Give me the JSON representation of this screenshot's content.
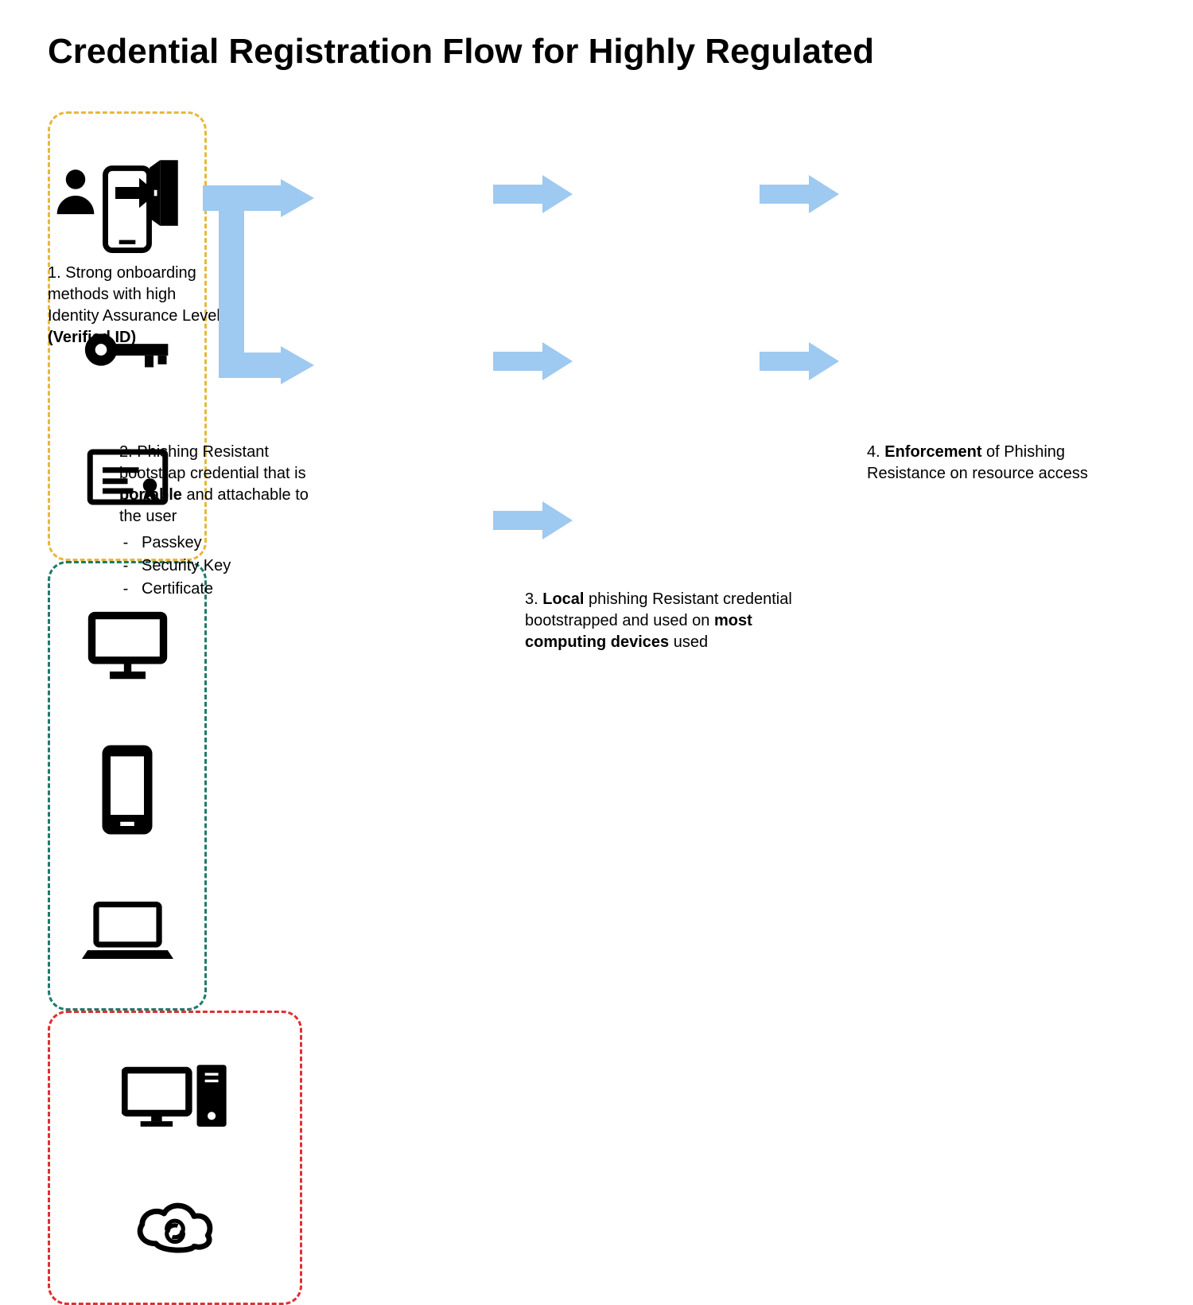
{
  "title": "Credential Registration Flow for Highly Regulated",
  "step1": {
    "prefix": "1. Strong onboarding methods with high Identity Assurance Level ",
    "bold": "(Verified ID)"
  },
  "step2": {
    "line1": "2. Phishing Resistant bootstrap credential that is ",
    "bold1": "portable",
    "line2": " and attachable to the user",
    "bullets": [
      "Passkey",
      "Security Key",
      "Certificate"
    ]
  },
  "step3": {
    "prefix": "3. ",
    "bold1": "Local",
    "mid": " phishing Resistant credential bootstrapped and used on ",
    "bold2": "most computing devices",
    "suffix": " used"
  },
  "step4": {
    "prefix": "4. ",
    "bold": "Enforcement",
    "suffix": " of Phishing Resistance on resource access"
  },
  "colors": {
    "yellow": "#E8B83E",
    "teal": "#1E7B6B",
    "red": "#E03030",
    "arrow": "#9EC9F0"
  }
}
